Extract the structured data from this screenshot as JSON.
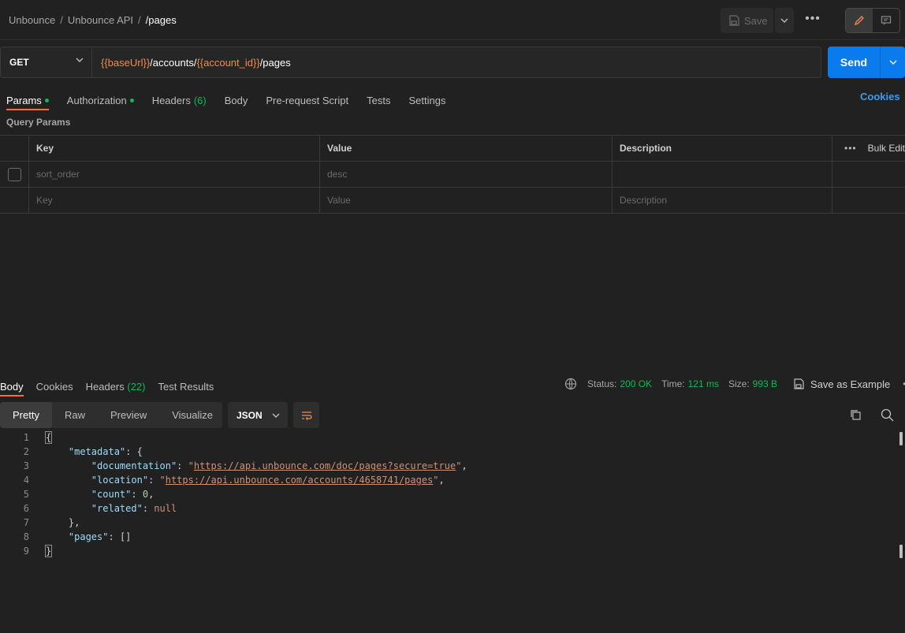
{
  "header": {
    "breadcrumbs": [
      "Unbounce",
      "Unbounce API",
      "/pages"
    ],
    "separator": "/",
    "save_label": "Save"
  },
  "request": {
    "method": "GET",
    "url_parts": [
      {
        "text": "{{baseUrl}}",
        "var": true
      },
      {
        "text": "/accounts/",
        "var": false
      },
      {
        "text": "{{account_id}}",
        "var": true
      },
      {
        "text": "/pages",
        "var": false
      }
    ],
    "send_label": "Send"
  },
  "tabs": {
    "params": "Params",
    "authorization": "Authorization",
    "headers": "Headers",
    "headers_count": "(6)",
    "body": "Body",
    "prerequest": "Pre-request Script",
    "tests": "Tests",
    "settings": "Settings",
    "cookies": "Cookies"
  },
  "query_params": {
    "title": "Query Params",
    "columns": {
      "key": "Key",
      "value": "Value",
      "description": "Description",
      "bulk_edit": "Bulk Edit"
    },
    "row": {
      "key": "sort_order",
      "value": "desc",
      "description": ""
    },
    "placeholder": {
      "key": "Key",
      "value": "Value",
      "description": "Description"
    }
  },
  "response": {
    "tabs": {
      "body": "Body",
      "cookies": "Cookies",
      "headers": "Headers",
      "headers_count": "(22)",
      "test_results": "Test Results"
    },
    "status_label": "Status:",
    "status_value": "200 OK",
    "time_label": "Time:",
    "time_value": "121 ms",
    "size_label": "Size:",
    "size_value": "993 B",
    "save_example": "Save as Example",
    "views": [
      "Pretty",
      "Raw",
      "Preview",
      "Visualize"
    ],
    "format": "JSON"
  },
  "code": {
    "line_numbers": [
      "1",
      "2",
      "3",
      "4",
      "5",
      "6",
      "7",
      "8",
      "9"
    ],
    "open_brace": "{",
    "metadata_key": "\"metadata\"",
    "documentation_key": "\"documentation\"",
    "documentation_val": "https://api.unbounce.com/doc/pages?secure=true",
    "location_key": "\"location\"",
    "location_val": "https://api.unbounce.com/accounts/4658741/pages",
    "count_key": "\"count\"",
    "count_val": "0",
    "related_key": "\"related\"",
    "related_val": "null",
    "pages_key": "\"pages\"",
    "pages_val": "[]",
    "close_brace": "}"
  },
  "colors": {
    "accent": "#ff6c37",
    "send": "#097bed",
    "status_ok": "#0cbb52",
    "variable": "#f28b54",
    "link": "#3d9be9"
  }
}
